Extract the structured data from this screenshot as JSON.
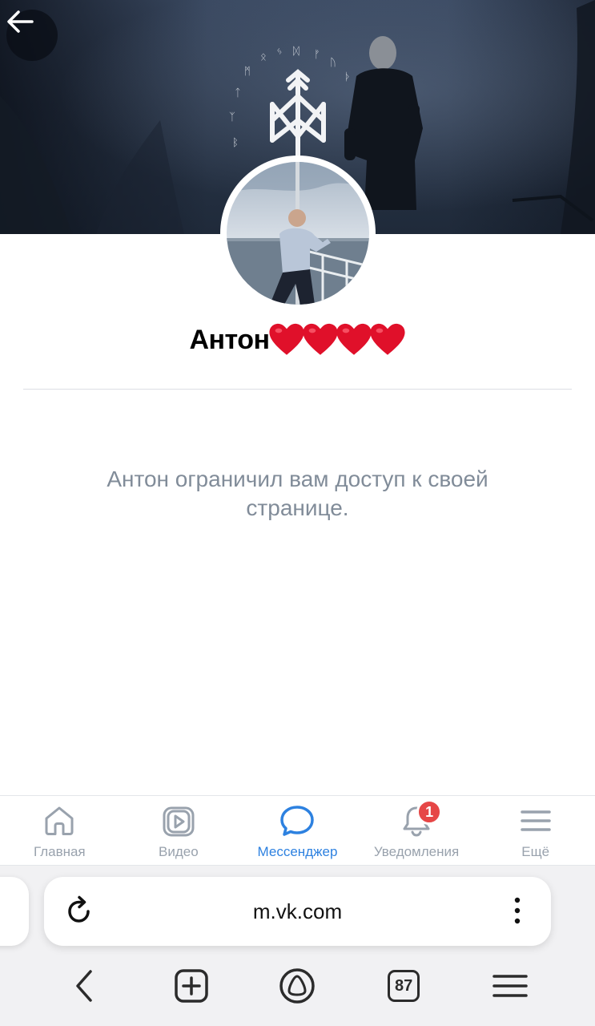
{
  "profile": {
    "name": "Антон",
    "restricted_message": "Антон ограничил вам доступ к своей странице."
  },
  "tabbar": {
    "items": [
      {
        "label": "Главная",
        "icon": "home-icon"
      },
      {
        "label": "Видео",
        "icon": "video-icon"
      },
      {
        "label": "Мессенджер",
        "icon": "messenger-icon",
        "active": true
      },
      {
        "label": "Уведомления",
        "icon": "bell-icon",
        "badge": "1"
      },
      {
        "label": "Ещё",
        "icon": "menu-icon"
      }
    ]
  },
  "browser": {
    "url": "m.vk.com",
    "tabs_count": "87"
  },
  "colors": {
    "accent": "#2d81e0",
    "tab_inactive": "#99a2ad",
    "badge": "#e64646",
    "secondary_text": "#818c99"
  }
}
